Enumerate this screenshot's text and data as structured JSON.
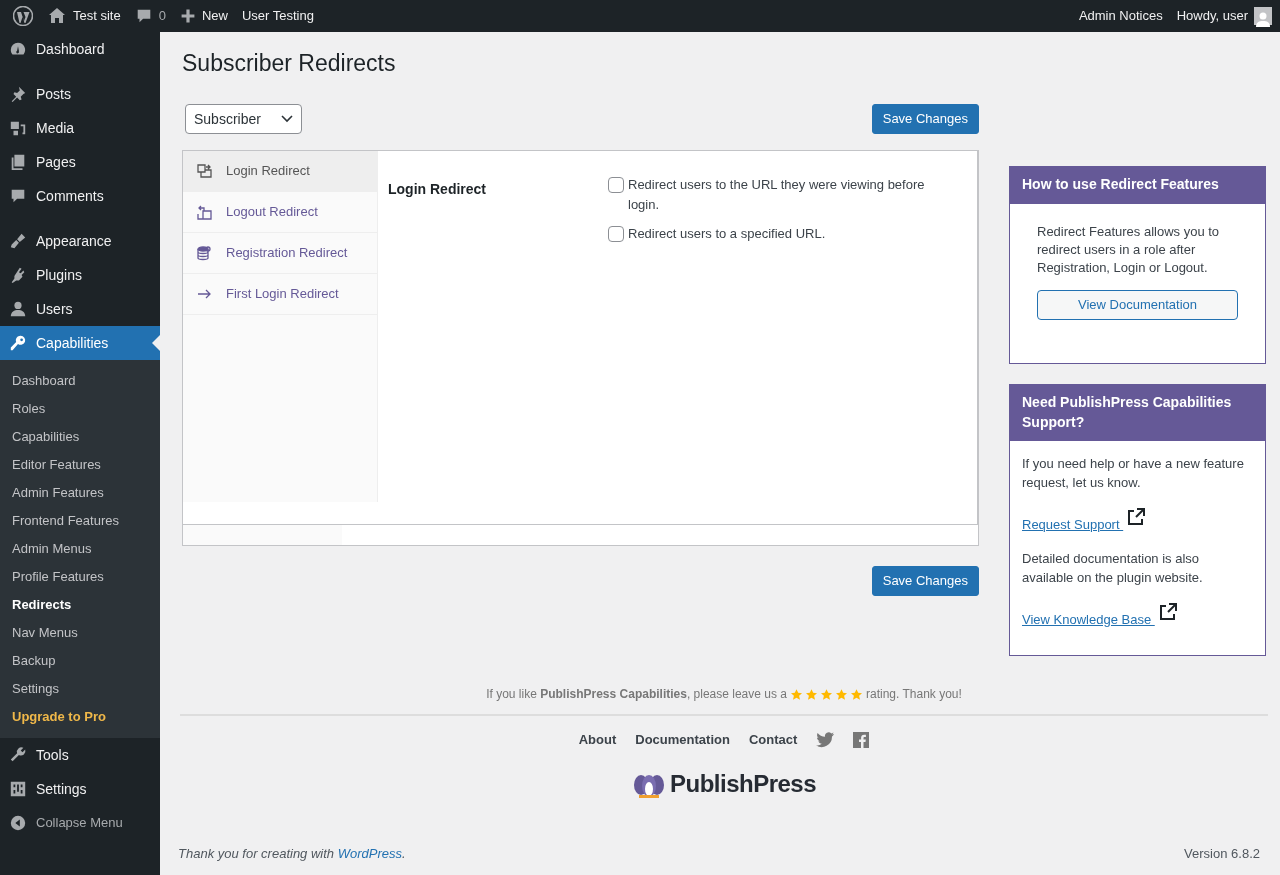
{
  "admin_bar": {
    "site": "Test site",
    "comments": "0",
    "new": "New",
    "extra": "User Testing",
    "notices": "Admin Notices",
    "howdy": "Howdy, user"
  },
  "sidebar": {
    "groups": [
      [
        {
          "label": "Dashboard",
          "selected": false
        }
      ],
      [
        {
          "label": "Posts",
          "selected": false
        },
        {
          "label": "Media",
          "selected": false
        },
        {
          "label": "Pages",
          "selected": false
        },
        {
          "label": "Comments",
          "selected": false
        }
      ],
      [
        {
          "label": "Appearance",
          "selected": false
        },
        {
          "label": "Plugins",
          "selected": false
        },
        {
          "label": "Users",
          "selected": false
        },
        {
          "label": "Capabilities",
          "selected": true,
          "submenu": [
            {
              "label": "Dashboard",
              "kind": "link",
              "selected": false
            },
            {
              "label": "Roles",
              "kind": "link",
              "selected": false
            },
            {
              "label": "Capabilities",
              "kind": "link",
              "selected": false
            },
            {
              "label": "Editor Features",
              "kind": "link",
              "selected": false
            },
            {
              "label": "Admin Features",
              "kind": "link",
              "selected": false
            },
            {
              "label": "Frontend Features",
              "kind": "link",
              "selected": false
            },
            {
              "label": "Admin Menus",
              "kind": "link",
              "selected": false
            },
            {
              "label": "Profile Features",
              "kind": "link",
              "selected": false
            },
            {
              "label": "Redirects",
              "kind": "link",
              "selected": true
            },
            {
              "label": "Nav Menus",
              "kind": "link",
              "selected": false
            },
            {
              "label": "Backup",
              "kind": "link",
              "selected": false
            },
            {
              "label": "Settings",
              "kind": "link",
              "selected": false
            },
            {
              "label": "Upgrade to Pro",
              "kind": "upgrade",
              "selected": false
            }
          ]
        },
        {
          "label": "Tools",
          "selected": false
        },
        {
          "label": "Settings",
          "selected": false
        }
      ]
    ],
    "collapse": "Collapse Menu"
  },
  "page": {
    "title": "Subscriber Redirects",
    "role_select": {
      "value": "Subscriber"
    },
    "save_top": "Save Changes",
    "save_bottom": "Save Changes",
    "tabs": [
      {
        "label": "Login Redirect",
        "selected": true
      },
      {
        "label": "Logout Redirect",
        "selected": false
      },
      {
        "label": "Registration Redirect",
        "selected": false
      },
      {
        "label": "First Login Redirect",
        "selected": false
      }
    ],
    "panel": {
      "heading": "Login Redirect",
      "options": [
        {
          "label": "Redirect users to the URL they were viewing before login.",
          "checked": false
        },
        {
          "label": "Redirect users to a specified URL.",
          "checked": false
        }
      ]
    }
  },
  "help_box": {
    "title": "How to use Redirect Features",
    "text": "Redirect Features allows you to redirect users in a role after Registration, Login or Logout.",
    "button": "View Documentation"
  },
  "support_box": {
    "title": "Need PublishPress Capabilities Support?",
    "items": [
      {
        "kind": "text",
        "text": "If you need help or have a new feature request, let us know."
      },
      {
        "kind": "link",
        "text": "Request Support"
      },
      {
        "kind": "text",
        "text": "Detailed documentation is also available on the plugin website."
      },
      {
        "kind": "link",
        "text": "View Knowledge Base"
      }
    ]
  },
  "plugin_footer": {
    "rating_before": "If you like **PublishPress Capabilities**, please leave us a",
    "stars": 5,
    "rating_after": "rating. Thank you!",
    "links": [
      "About",
      "Documentation",
      "Contact"
    ],
    "logo": "PublishPress"
  },
  "wp_footer": {
    "credit_before": "Thank you for creating with",
    "credit_link": "WordPress",
    "credit_after": ".",
    "version": "Version 6.8.2"
  }
}
